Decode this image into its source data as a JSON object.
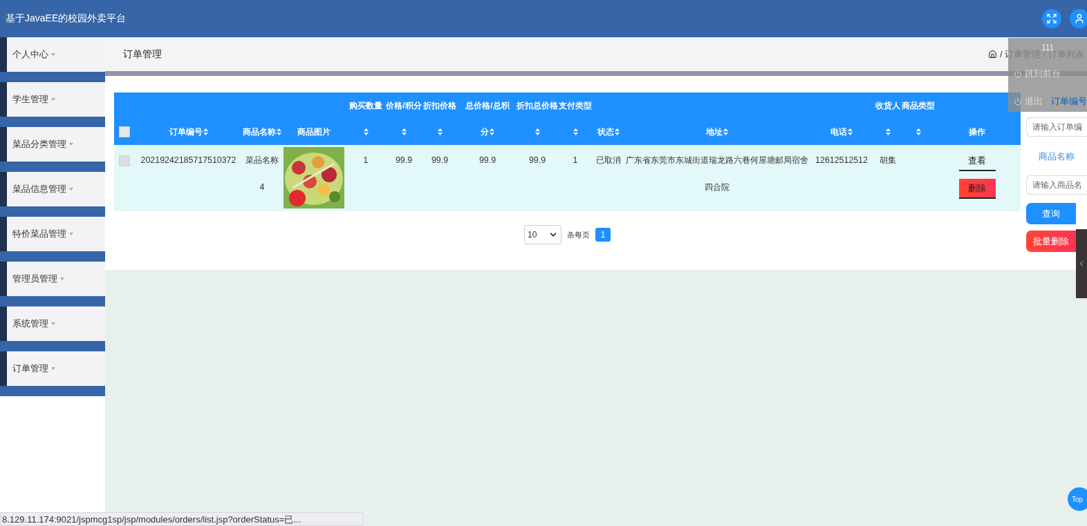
{
  "header": {
    "title": "基于JavaEE的校园外卖平台"
  },
  "sidebar": {
    "items": [
      {
        "label": "个人中心"
      },
      {
        "label": "学生管理"
      },
      {
        "label": "菜品分类管理"
      },
      {
        "label": "菜品信息管理"
      },
      {
        "label": "特价菜品管理"
      },
      {
        "label": "管理员管理"
      },
      {
        "label": "系统管理"
      },
      {
        "label": "订单管理"
      }
    ]
  },
  "page": {
    "title": "订单管理",
    "breadcrumb": "/ 订单管理 / 订单列表"
  },
  "table": {
    "header_checked": false,
    "columns": [
      {
        "line2": "订单编号",
        "sortable": true
      },
      {
        "line2": "商品名称",
        "sortable": true
      },
      {
        "line2": "商品图片",
        "sortable": false
      },
      {
        "line1": "购买数量",
        "sortable": true
      },
      {
        "line1": "价格/积分",
        "sortable": true
      },
      {
        "line1": "折扣价格",
        "sortable": true
      },
      {
        "line1": "总价格/总积",
        "line2": "分",
        "sortable": true
      },
      {
        "line1": "折扣总价格",
        "sortable": true
      },
      {
        "line1": "支付类型",
        "sortable": true
      },
      {
        "line2": "状态",
        "sortable": true
      },
      {
        "line2": "地址",
        "sortable": true
      },
      {
        "line2": "电话",
        "sortable": true
      },
      {
        "line1": "收货人",
        "sortable": true
      },
      {
        "line1": "商品类型",
        "sortable": true
      },
      {
        "line2": "操作",
        "sortable": false
      }
    ],
    "rows": [
      {
        "checked": false,
        "cells": [
          {
            "kind": "text",
            "text": "20219242185717510372"
          },
          {
            "kind": "text",
            "text": "菜品名称4"
          },
          {
            "kind": "picture"
          },
          {
            "kind": "text",
            "text": "1"
          },
          {
            "kind": "text",
            "text": "99.9"
          },
          {
            "kind": "text",
            "text": "99.9"
          },
          {
            "kind": "text",
            "text": "99.9"
          },
          {
            "kind": "text",
            "text": "99.9"
          },
          {
            "kind": "text",
            "text": "1"
          },
          {
            "kind": "text",
            "text": "已取消"
          },
          {
            "kind": "text",
            "text": "广东省东莞市东城街道瑞龙路六巷何屋塘邮局宿舍四合院"
          },
          {
            "kind": "text",
            "text": "12612512512"
          },
          {
            "kind": "text",
            "text": "胡集"
          },
          {
            "kind": "empty"
          }
        ],
        "actions": [
          {
            "label": "查看",
            "kind": "view"
          },
          {
            "label": "删除",
            "kind": "delete"
          }
        ]
      }
    ]
  },
  "pagination": {
    "page_size": "10",
    "per_page_label": "条每页",
    "pages": [
      {
        "label": "1",
        "selected": true
      }
    ]
  },
  "search": {
    "fields": [
      {
        "label": "订单编号",
        "placeholder": "请输入订单编"
      },
      {
        "label": "商品名称",
        "placeholder": "请输入商品名"
      }
    ],
    "buttons": [
      {
        "label": "查询",
        "kind": "primary"
      },
      {
        "label": "批量删除",
        "kind": "danger"
      }
    ]
  },
  "user_menu": {
    "username": "111",
    "items": [
      "跳到前台",
      "退出"
    ]
  },
  "scroll_top": {
    "label": "Top"
  },
  "status_url": "8.129.11.174:9021/jspmcg1sp/jsp/modules/orders/list.jsp?orderStatus=已..."
}
